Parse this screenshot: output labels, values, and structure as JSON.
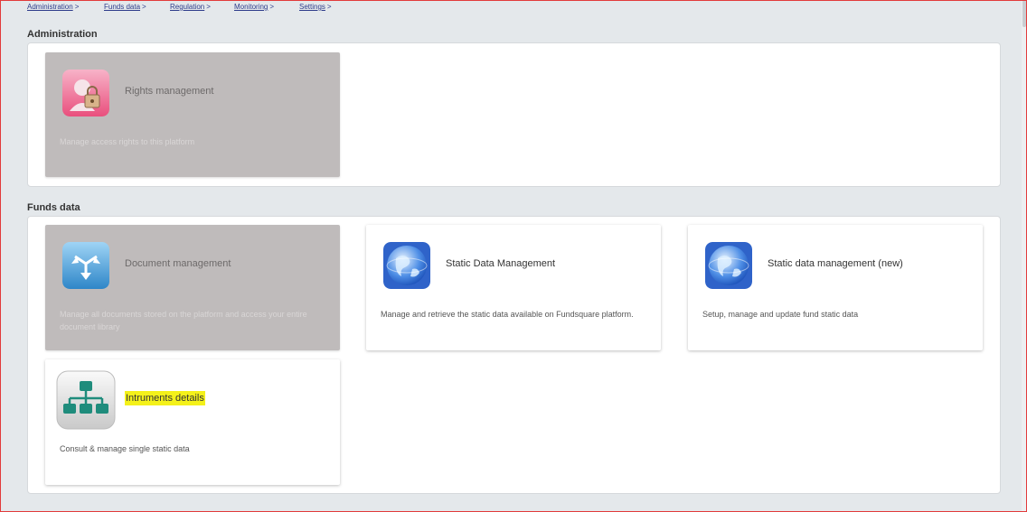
{
  "breadcrumb": [
    {
      "label": "Administration",
      "sep": ">"
    },
    {
      "label": "Funds data",
      "sep": ">"
    },
    {
      "label": "Regulation",
      "sep": ">"
    },
    {
      "label": "Monitoring",
      "sep": ">"
    },
    {
      "label": "Settings",
      "sep": ">"
    }
  ],
  "sections": {
    "administration": {
      "title": "Administration",
      "cards": [
        {
          "title": "Rights management",
          "desc": "Manage access rights to this platform",
          "icon": "rights-lock-icon",
          "state": "disabled"
        }
      ]
    },
    "funds_data": {
      "title": "Funds data",
      "cards": [
        {
          "title": "Document management",
          "desc": "Manage all documents stored on the platform and access your entire document library",
          "icon": "document-arrows-icon",
          "state": "disabled"
        },
        {
          "title": "Static Data Management",
          "desc": "Manage and retrieve the static data available on Fundsquare platform.",
          "icon": "globe-icon",
          "state": "enabled"
        },
        {
          "title": "Static data management (new)",
          "desc": "Setup, manage and update fund static data",
          "icon": "globe-icon",
          "state": "enabled"
        },
        {
          "title": "Intruments details",
          "desc": "Consult & manage single static data",
          "icon": "hierarchy-icon",
          "state": "enabled",
          "highlighted": true
        }
      ]
    }
  },
  "colors": {
    "page_bg": "#e4e8eb",
    "disabled_card": "#bfbbbb",
    "link": "#2d3b8a",
    "highlight": "#f4f11a",
    "frame": "#e23b3b"
  }
}
